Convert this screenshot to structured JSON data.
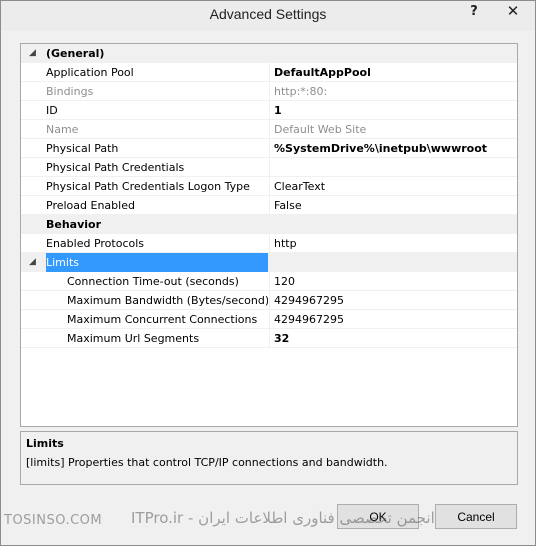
{
  "window": {
    "title": "Advanced Settings",
    "help_glyph": "?",
    "close_glyph": "✕"
  },
  "grid": {
    "categories": {
      "general": "(General)",
      "behavior": "Behavior"
    },
    "general_rows": [
      {
        "name": "Application Pool",
        "value": "DefaultAppPool"
      },
      {
        "name": "Bindings",
        "value": "http:*:80:"
      },
      {
        "name": "ID",
        "value": "1"
      },
      {
        "name": "Name",
        "value": "Default Web Site"
      },
      {
        "name": "Physical Path",
        "value": "%SystemDrive%\\inetpub\\wwwroot"
      },
      {
        "name": "Physical Path Credentials",
        "value": ""
      },
      {
        "name": "Physical Path Credentials Logon Type",
        "value": "ClearText"
      },
      {
        "name": "Preload Enabled",
        "value": "False"
      }
    ],
    "behavior_rows": [
      {
        "name": "Enabled Protocols",
        "value": "http"
      },
      {
        "name": "Limits",
        "value": ""
      }
    ],
    "limits_rows": [
      {
        "name": "Connection Time-out (seconds)",
        "value": "120"
      },
      {
        "name": "Maximum Bandwidth (Bytes/second)",
        "value": "4294967295"
      },
      {
        "name": "Maximum Concurrent Connections",
        "value": "4294967295"
      },
      {
        "name": "Maximum Url Segments",
        "value": "32"
      }
    ]
  },
  "description": {
    "title": "Limits",
    "text": "[limits] Properties that control TCP/IP connections and bandwidth."
  },
  "buttons": {
    "ok": "OK",
    "cancel": "Cancel"
  },
  "watermark": {
    "left": "TOSINSO.COM",
    "right": "انجمن تخصصی فناوری اطلاعات ایران - ITPro.ir"
  }
}
